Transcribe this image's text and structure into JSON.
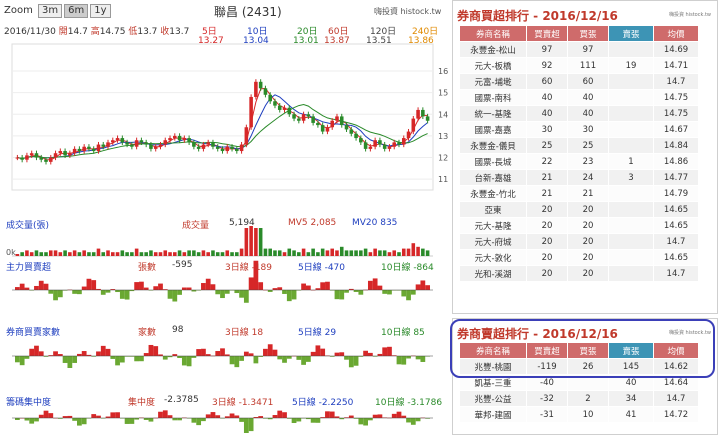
{
  "left": {
    "zoom_label": "Zoom",
    "zoom_buttons": [
      "3m",
      "6m",
      "1y"
    ],
    "zoom_selected": "6m",
    "stock_title": "聯昌 (2431)",
    "source": "嗨投資 histock.tw",
    "ohlc": {
      "date": "2016/11/30",
      "open_label": "開",
      "open": "14.7",
      "high": "14.75",
      "high_label": "高",
      "low_label": "低",
      "low": "13.7",
      "close_label": "收",
      "close": "13.7"
    },
    "ma": [
      {
        "label": "5日",
        "value": "13.27",
        "color": "#d62728"
      },
      {
        "label": "10日",
        "value": "13.04",
        "color": "#1f3fbf"
      },
      {
        "label": "20日",
        "value": "13.01",
        "color": "#2a8a2a"
      },
      {
        "label": "60日",
        "value": "13.87",
        "color": "#c0392b"
      },
      {
        "label": "120日",
        "value": "13.51",
        "color": "#444444"
      },
      {
        "label": "240日",
        "value": "13.86",
        "color": "#e08a00"
      }
    ],
    "vol_label": "成交量(張)",
    "vol_title": "成交量",
    "vol_value": "5,194",
    "vol_ma5": "MV5 2,085",
    "vol_ma20": "MV20 835",
    "main_label": "主力買賣超",
    "main_vals": [
      "張數",
      "-595",
      "3日線 -189",
      "5日線 -470",
      "10日線 -864"
    ],
    "dealer_label": "券商買賣家數",
    "dealer_vals": [
      "家數",
      "98",
      "3日線 18",
      "5日線 29",
      "10日線 85"
    ],
    "conc_label": "籌碼集中度",
    "conc_vals": [
      "集中度",
      "-2.3785",
      "3日線 -1.3471",
      "5日線 -2.2250",
      "10日線 -3.1786"
    ]
  },
  "chart_data": {
    "type": "line",
    "title": "聯昌 (2431)",
    "ylim": [
      10.5,
      16.6
    ],
    "y_ticks": [
      "16",
      "15",
      "14",
      "13",
      "12",
      "11"
    ],
    "volume_axis_label": "0k",
    "close": [
      12.0,
      11.9,
      12.1,
      12.2,
      12.0,
      11.9,
      11.8,
      12.0,
      12.2,
      12.3,
      12.1,
      12.2,
      12.4,
      12.3,
      12.5,
      12.4,
      12.3,
      12.6,
      12.5,
      12.7,
      12.8,
      12.9,
      12.7,
      12.6,
      12.5,
      12.8,
      12.7,
      12.6,
      12.4,
      12.5,
      12.6,
      12.8,
      12.9,
      13.0,
      12.8,
      12.9,
      12.7,
      12.5,
      12.4,
      12.6,
      12.7,
      12.5,
      12.4,
      12.3,
      12.5,
      12.4,
      12.3,
      12.6,
      13.4,
      14.8,
      15.5,
      15.2,
      14.9,
      14.6,
      14.4,
      14.2,
      14.3,
      14.0,
      13.8,
      13.7,
      14.0,
      13.9,
      13.6,
      13.5,
      13.2,
      13.4,
      13.7,
      13.9,
      13.5,
      13.3,
      13.1,
      12.9,
      12.7,
      12.4,
      12.5,
      12.8,
      12.6,
      12.4,
      12.5,
      12.7,
      12.6,
      12.9,
      13.2,
      13.8,
      14.2,
      13.9,
      13.7
    ]
  },
  "right": {
    "buy_title": "券商買超排行 - 2016/12/16",
    "sell_title": "券商賣超排行 - 2016/12/16",
    "source_small": "嗨投資 histock.tw",
    "headers": [
      "券商名稱",
      "買賣超",
      "買張",
      "賣張",
      "均價"
    ],
    "buy_rows": [
      [
        "永豐金-松山",
        "97",
        "97",
        "",
        "14.69"
      ],
      [
        "元大-板橋",
        "92",
        "111",
        "19",
        "14.71"
      ],
      [
        "元富-埔墘",
        "60",
        "60",
        "",
        "14.7"
      ],
      [
        "國票-南科",
        "40",
        "40",
        "",
        "14.75"
      ],
      [
        "統一-基隆",
        "40",
        "40",
        "",
        "14.75"
      ],
      [
        "國票-嘉嘉",
        "30",
        "30",
        "",
        "14.67"
      ],
      [
        "永豐金-儀貝",
        "25",
        "25",
        "",
        "14.84"
      ],
      [
        "國票-長城",
        "22",
        "23",
        "1",
        "14.86"
      ],
      [
        "台新-嘉雄",
        "21",
        "24",
        "3",
        "14.77"
      ],
      [
        "永豐金-竹北",
        "21",
        "21",
        "",
        "14.79"
      ],
      [
        "亞東",
        "20",
        "20",
        "",
        "14.65"
      ],
      [
        "元大-基隆",
        "20",
        "20",
        "",
        "14.65"
      ],
      [
        "元大-府城",
        "20",
        "20",
        "",
        "14.7"
      ],
      [
        "元大-敦化",
        "20",
        "20",
        "",
        "14.65"
      ],
      [
        "光和-溪湖",
        "20",
        "20",
        "",
        "14.7"
      ]
    ],
    "sell_rows": [
      [
        "兆豐-桃園",
        "-119",
        "26",
        "145",
        "14.62"
      ],
      [
        "凱基-三重",
        "-40",
        "",
        "40",
        "14.64"
      ],
      [
        "兆豐-公益",
        "-32",
        "2",
        "34",
        "14.7"
      ],
      [
        "華邦-建國",
        "-31",
        "10",
        "41",
        "14.72"
      ]
    ]
  }
}
